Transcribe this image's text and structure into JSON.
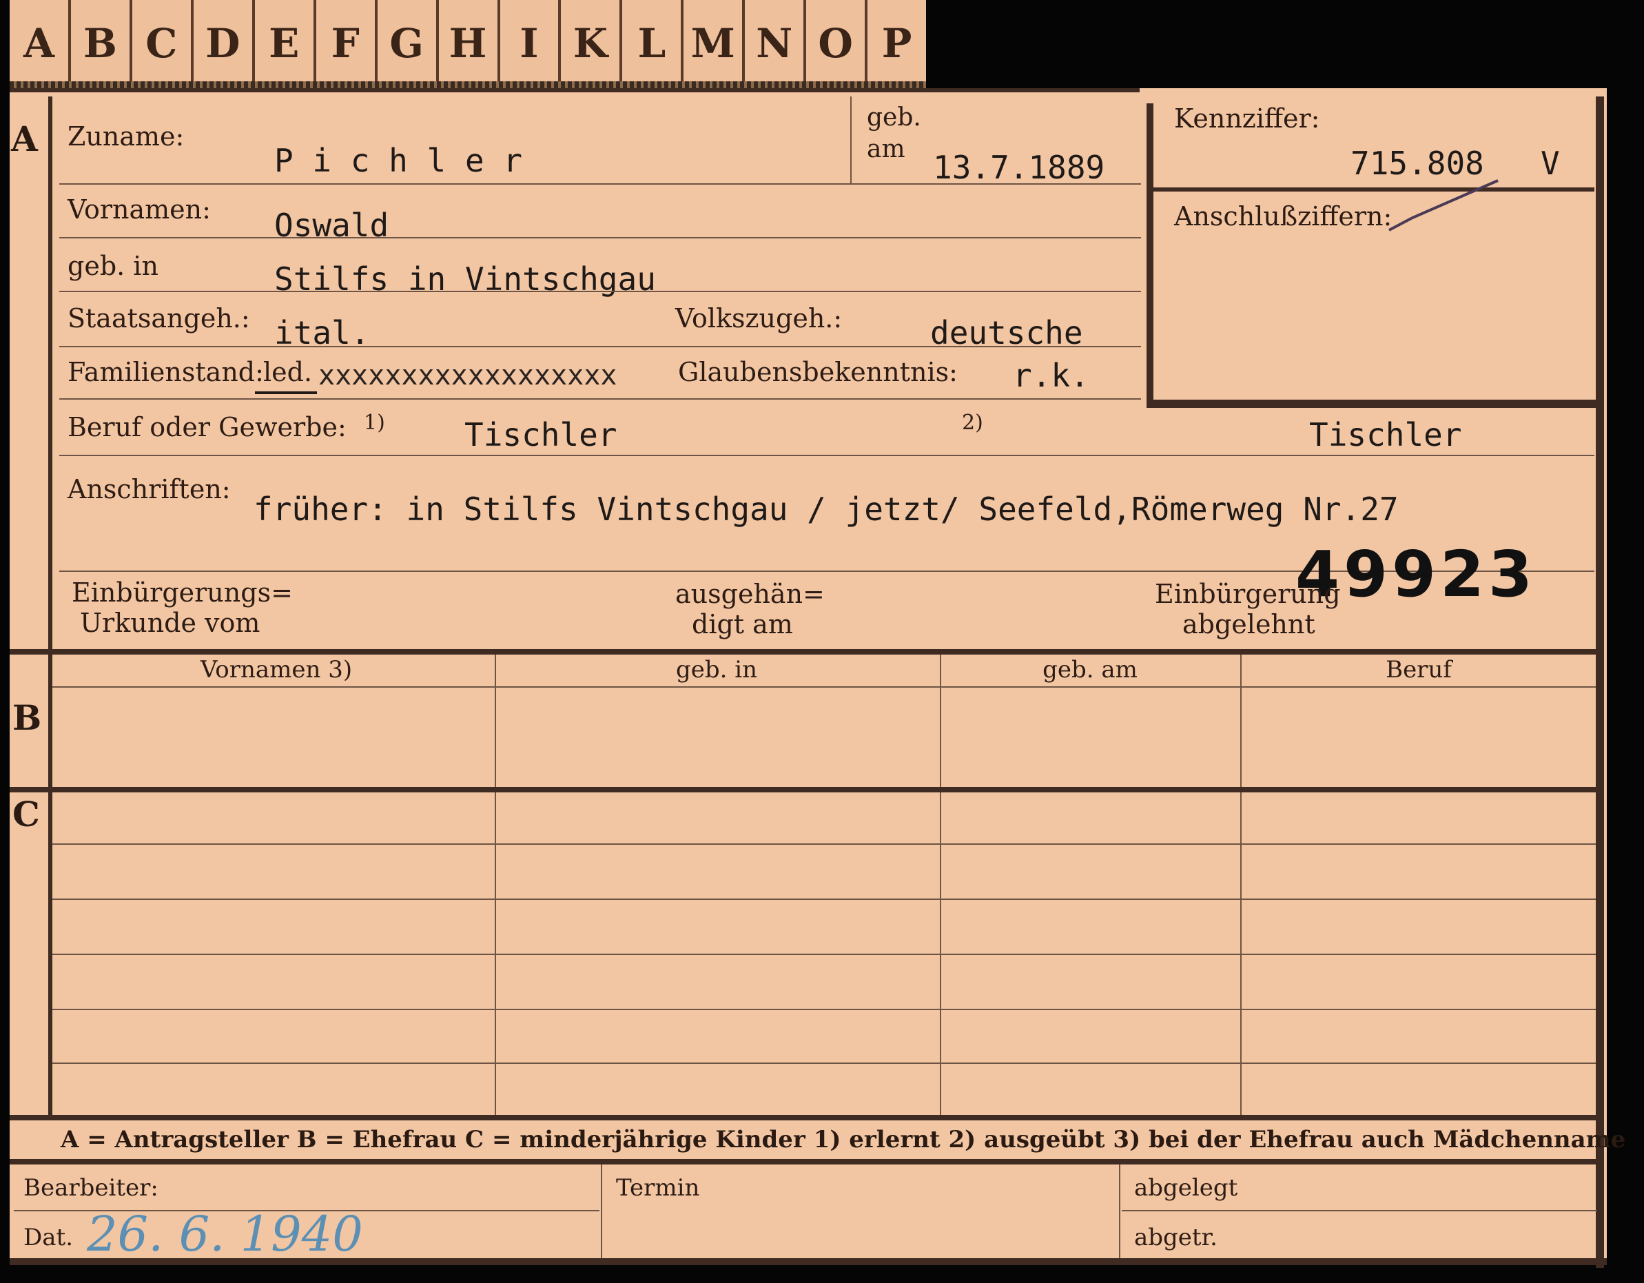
{
  "tabs": [
    "A",
    "B",
    "C",
    "D",
    "E",
    "F",
    "G",
    "H",
    "I",
    "K",
    "L",
    "M",
    "N",
    "O",
    "P"
  ],
  "section_letters": {
    "a": "A",
    "b": "B",
    "c": "C"
  },
  "fields": {
    "zuname_label": "Zuname:",
    "zuname_value": "P i c h l e r",
    "geb_am_label_1": "geb.",
    "geb_am_label_2": "am",
    "geb_am_value": "13.7.1889",
    "vornamen_label": "Vornamen:",
    "vornamen_value": "Oswald",
    "geb_in_label": "geb. in",
    "geb_in_value": "Stilfs in Vintschgau",
    "staatsangeh_label": "Staatsangeh.:",
    "staatsangeh_value": "ital.",
    "volkszugeh_label": "Volkszugeh.:",
    "volkszugeh_value": "deutsche",
    "familienstand_label": "Familienstand:",
    "familienstand_value": "led.",
    "familienstand_struck": "xxxxxxxxxxxxxxxxxx",
    "glauben_label": "Glaubensbekenntnis:",
    "glauben_value": "r.k.",
    "beruf_label": "Beruf oder Gewerbe:",
    "beruf_mark_1": "1)",
    "beruf_value_1": "Tischler",
    "beruf_mark_2": "2)",
    "beruf_value_2": "Tischler",
    "anschriften_label": "Anschriften:",
    "anschriften_value": "früher: in Stilfs Vintschgau / jetzt/ Seefeld,Römerweg Nr.27",
    "stamp_number": "49923",
    "einbuergerungs_label_1": "Einbürgerungs=",
    "einbuergerungs_label_2": "Urkunde vom",
    "ausgehaen_label_1": "ausgehän=",
    "ausgehaen_label_2": "digt am",
    "abgelehnt_label_1": "Einbürgerung",
    "abgelehnt_label_2": "abgelehnt"
  },
  "kennziffer": {
    "label": "Kennziffer:",
    "value": "715.808",
    "suffix": "V",
    "anschluss_label": "Anschlußziffern:"
  },
  "table": {
    "columns": [
      "Vornamen 3)",
      "geb. in",
      "geb. am",
      "Beruf"
    ]
  },
  "legend": "A = Antragsteller   B = Ehefrau   C = minderjährige Kinder   1) erlernt   2) ausgeübt   3) bei der Ehefrau auch Mädchenname",
  "footer": {
    "bearbeiter_label": "Bearbeiter:",
    "dat_label": "Dat.",
    "dat_value": "26. 6. 1940",
    "termin_label": "Termin",
    "abgelegt_label": "abgelegt",
    "abgetr_label": "abgetr."
  }
}
